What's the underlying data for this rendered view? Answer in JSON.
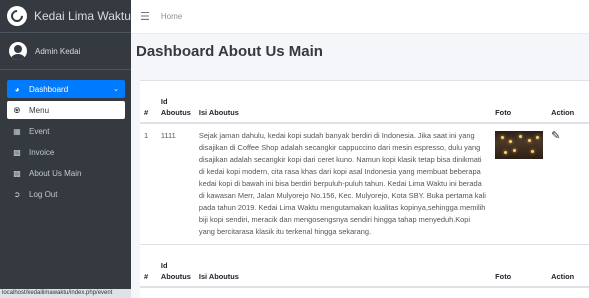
{
  "brand": {
    "title": "Kedai Lima Waktu"
  },
  "user": {
    "name": "Admin Kedai"
  },
  "sidebar": {
    "items": [
      {
        "label": "Dashboard",
        "icon": "dashboard-icon"
      },
      {
        "label": "Menu",
        "icon": "utensils-icon"
      },
      {
        "label": "Event",
        "icon": "calendar-icon"
      },
      {
        "label": "Invoice",
        "icon": "invoice-icon"
      },
      {
        "label": "About Us Main",
        "icon": "about-icon"
      },
      {
        "label": "Log Out",
        "icon": "logout-icon"
      }
    ]
  },
  "statusbar": {
    "url": "localhost/kedailimawaktu/index.php/event"
  },
  "topbar": {
    "home": "Home"
  },
  "page": {
    "title": "Dashboard About Us Main"
  },
  "table": {
    "headers": {
      "no": "#",
      "id": "Id Aboutus",
      "isi": "Isi Aboutus",
      "foto": "Foto",
      "action": "Action"
    },
    "rows": [
      {
        "no": "1",
        "id": "1111",
        "isi": "Sejak jaman dahulu, kedai kopi sudah banyak berdiri di Indonesia. Jika saat ini yang disajikan di Coffee Shop adalah secangkir cappuccino dari mesin espresso, dulu yang disajikan adalah secangkir kopi dari ceret kuno. Namun kopi klasik tetap bisa dinikmati di kedai kopi modern, cita rasa khas dari kopi asal Indonesia yang membuat beberapa kedai kopi di bawah ini bisa berdiri berpuluh-puluh tahun. Kedai Lima Waktu ini berada di kawasan Merr, Jalan Mulyorejo No.156, Kec. Mulyorejo, Kota SBY. Buka pertama kali pada tahun 2019. Kedai Lima Waktu mengutamakan kualitas kopinya,sehingga memilih biji kopi sendiri, meracik dan mengosengsnya sendiri hingga tahap menyeduh.Kopi yang bercitarasa klasik itu terkenal hingga sekarang."
      }
    ]
  }
}
